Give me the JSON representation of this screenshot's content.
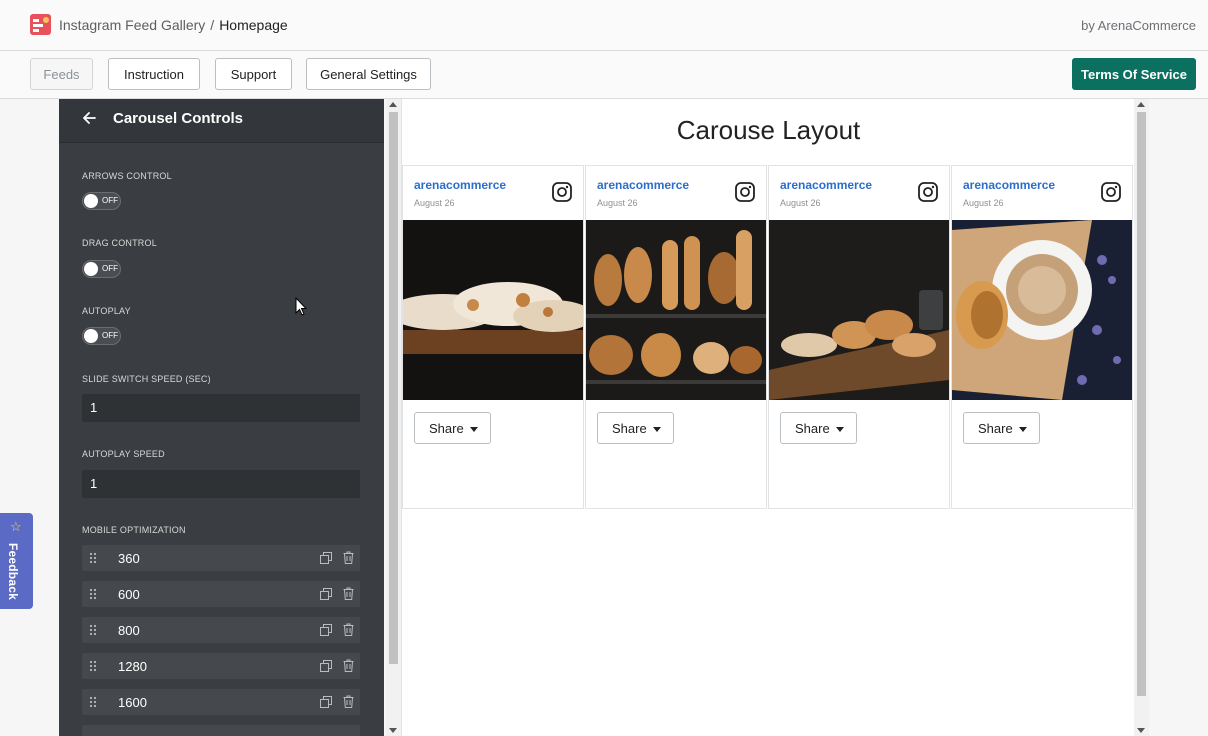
{
  "header": {
    "app_name": "Instagram Feed Gallery",
    "separator": "/",
    "page": "Homepage",
    "byline": "by ArenaCommerce"
  },
  "nav": {
    "feeds": "Feeds",
    "instruction": "Instruction",
    "support": "Support",
    "general_settings": "General Settings",
    "terms": "Terms Of Service"
  },
  "sidebar": {
    "title": "Carousel Controls",
    "arrows_label": "ARROWS CONTROL",
    "arrows_state": "OFF",
    "drag_label": "DRAG CONTROL",
    "drag_state": "OFF",
    "autoplay_label": "AUTOPLAY",
    "autoplay_state": "OFF",
    "slide_speed_label": "SLIDE SWITCH SPEED (SEC)",
    "slide_speed_value": "1",
    "autoplay_speed_label": "AUTOPLAY SPEED",
    "autoplay_speed_value": "1",
    "mobile_label": "MOBILE OPTIMIZATION",
    "breakpoints": [
      "360",
      "600",
      "800",
      "1280",
      "1600"
    ]
  },
  "feedback": {
    "label": "Feedback"
  },
  "preview": {
    "title": "Carouse Layout",
    "cards": [
      {
        "username": "arenacommerce",
        "date": "August 26",
        "share": "Share",
        "image": "flatbread-photo"
      },
      {
        "username": "arenacommerce",
        "date": "August 26",
        "share": "Share",
        "image": "bakery-shelf-photo"
      },
      {
        "username": "arenacommerce",
        "date": "August 26",
        "share": "Share",
        "image": "bread-rolls-photo"
      },
      {
        "username": "arenacommerce",
        "date": "August 26",
        "share": "Share",
        "image": "coffee-croissant-photo"
      }
    ]
  },
  "colors": {
    "accent": "#0b7060",
    "sidebar_bg": "#3a3d41",
    "link": "#2c6ecb",
    "feedback": "#5b6ac4"
  }
}
